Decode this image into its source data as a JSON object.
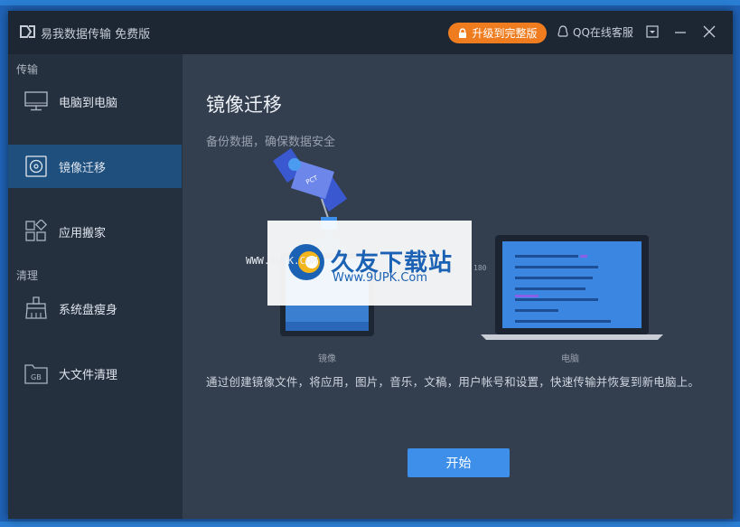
{
  "app": {
    "title": "易我数据传输 免费版",
    "upgrade_label": "升级到完整版",
    "support_label": "QQ在线客服"
  },
  "sidebar": {
    "section_transfer": "传输",
    "section_clean": "清理",
    "items": [
      {
        "label": "电脑到电脑",
        "icon": "monitor-icon"
      },
      {
        "label": "镜像迁移",
        "icon": "disc-icon"
      },
      {
        "label": "应用搬家",
        "icon": "apps-grid-icon"
      },
      {
        "label": "系统盘瘦身",
        "icon": "broom-icon"
      },
      {
        "label": "大文件清理",
        "icon": "gb-folder-icon"
      }
    ],
    "active_item": "镜像迁移"
  },
  "main": {
    "title": "镜像迁移",
    "subtitle": "备份数据，确保数据安全",
    "caption_left": "镜像",
    "caption_right": "电脑",
    "satellite_label": "PCT",
    "description": "通过创建镜像文件，将应用，图片，音乐，文稿，用户帐号和设置，快速传输并恢复到新电脑上。",
    "start_label": "开始"
  },
  "watermark": {
    "brand": "久友下载站",
    "url": "Www.9UPK.Com",
    "left_text": "WWW.9UPK.COM",
    "right_text": "180"
  },
  "colors": {
    "accent": "#3d8fea",
    "upgrade": "#ef7d20",
    "active_nav": "#1e4f7d"
  }
}
